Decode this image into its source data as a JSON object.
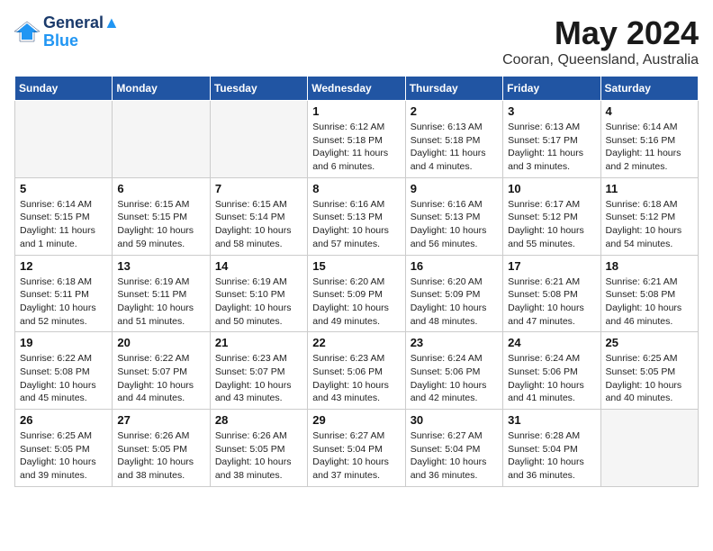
{
  "header": {
    "logo_line1": "General",
    "logo_line2": "Blue",
    "month_year": "May 2024",
    "location": "Cooran, Queensland, Australia"
  },
  "weekdays": [
    "Sunday",
    "Monday",
    "Tuesday",
    "Wednesday",
    "Thursday",
    "Friday",
    "Saturday"
  ],
  "weeks": [
    [
      {
        "day": "",
        "info": ""
      },
      {
        "day": "",
        "info": ""
      },
      {
        "day": "",
        "info": ""
      },
      {
        "day": "1",
        "info": "Sunrise: 6:12 AM\nSunset: 5:18 PM\nDaylight: 11 hours and 6 minutes."
      },
      {
        "day": "2",
        "info": "Sunrise: 6:13 AM\nSunset: 5:18 PM\nDaylight: 11 hours and 4 minutes."
      },
      {
        "day": "3",
        "info": "Sunrise: 6:13 AM\nSunset: 5:17 PM\nDaylight: 11 hours and 3 minutes."
      },
      {
        "day": "4",
        "info": "Sunrise: 6:14 AM\nSunset: 5:16 PM\nDaylight: 11 hours and 2 minutes."
      }
    ],
    [
      {
        "day": "5",
        "info": "Sunrise: 6:14 AM\nSunset: 5:15 PM\nDaylight: 11 hours and 1 minute."
      },
      {
        "day": "6",
        "info": "Sunrise: 6:15 AM\nSunset: 5:15 PM\nDaylight: 10 hours and 59 minutes."
      },
      {
        "day": "7",
        "info": "Sunrise: 6:15 AM\nSunset: 5:14 PM\nDaylight: 10 hours and 58 minutes."
      },
      {
        "day": "8",
        "info": "Sunrise: 6:16 AM\nSunset: 5:13 PM\nDaylight: 10 hours and 57 minutes."
      },
      {
        "day": "9",
        "info": "Sunrise: 6:16 AM\nSunset: 5:13 PM\nDaylight: 10 hours and 56 minutes."
      },
      {
        "day": "10",
        "info": "Sunrise: 6:17 AM\nSunset: 5:12 PM\nDaylight: 10 hours and 55 minutes."
      },
      {
        "day": "11",
        "info": "Sunrise: 6:18 AM\nSunset: 5:12 PM\nDaylight: 10 hours and 54 minutes."
      }
    ],
    [
      {
        "day": "12",
        "info": "Sunrise: 6:18 AM\nSunset: 5:11 PM\nDaylight: 10 hours and 52 minutes."
      },
      {
        "day": "13",
        "info": "Sunrise: 6:19 AM\nSunset: 5:11 PM\nDaylight: 10 hours and 51 minutes."
      },
      {
        "day": "14",
        "info": "Sunrise: 6:19 AM\nSunset: 5:10 PM\nDaylight: 10 hours and 50 minutes."
      },
      {
        "day": "15",
        "info": "Sunrise: 6:20 AM\nSunset: 5:09 PM\nDaylight: 10 hours and 49 minutes."
      },
      {
        "day": "16",
        "info": "Sunrise: 6:20 AM\nSunset: 5:09 PM\nDaylight: 10 hours and 48 minutes."
      },
      {
        "day": "17",
        "info": "Sunrise: 6:21 AM\nSunset: 5:08 PM\nDaylight: 10 hours and 47 minutes."
      },
      {
        "day": "18",
        "info": "Sunrise: 6:21 AM\nSunset: 5:08 PM\nDaylight: 10 hours and 46 minutes."
      }
    ],
    [
      {
        "day": "19",
        "info": "Sunrise: 6:22 AM\nSunset: 5:08 PM\nDaylight: 10 hours and 45 minutes."
      },
      {
        "day": "20",
        "info": "Sunrise: 6:22 AM\nSunset: 5:07 PM\nDaylight: 10 hours and 44 minutes."
      },
      {
        "day": "21",
        "info": "Sunrise: 6:23 AM\nSunset: 5:07 PM\nDaylight: 10 hours and 43 minutes."
      },
      {
        "day": "22",
        "info": "Sunrise: 6:23 AM\nSunset: 5:06 PM\nDaylight: 10 hours and 43 minutes."
      },
      {
        "day": "23",
        "info": "Sunrise: 6:24 AM\nSunset: 5:06 PM\nDaylight: 10 hours and 42 minutes."
      },
      {
        "day": "24",
        "info": "Sunrise: 6:24 AM\nSunset: 5:06 PM\nDaylight: 10 hours and 41 minutes."
      },
      {
        "day": "25",
        "info": "Sunrise: 6:25 AM\nSunset: 5:05 PM\nDaylight: 10 hours and 40 minutes."
      }
    ],
    [
      {
        "day": "26",
        "info": "Sunrise: 6:25 AM\nSunset: 5:05 PM\nDaylight: 10 hours and 39 minutes."
      },
      {
        "day": "27",
        "info": "Sunrise: 6:26 AM\nSunset: 5:05 PM\nDaylight: 10 hours and 38 minutes."
      },
      {
        "day": "28",
        "info": "Sunrise: 6:26 AM\nSunset: 5:05 PM\nDaylight: 10 hours and 38 minutes."
      },
      {
        "day": "29",
        "info": "Sunrise: 6:27 AM\nSunset: 5:04 PM\nDaylight: 10 hours and 37 minutes."
      },
      {
        "day": "30",
        "info": "Sunrise: 6:27 AM\nSunset: 5:04 PM\nDaylight: 10 hours and 36 minutes."
      },
      {
        "day": "31",
        "info": "Sunrise: 6:28 AM\nSunset: 5:04 PM\nDaylight: 10 hours and 36 minutes."
      },
      {
        "day": "",
        "info": ""
      }
    ]
  ]
}
